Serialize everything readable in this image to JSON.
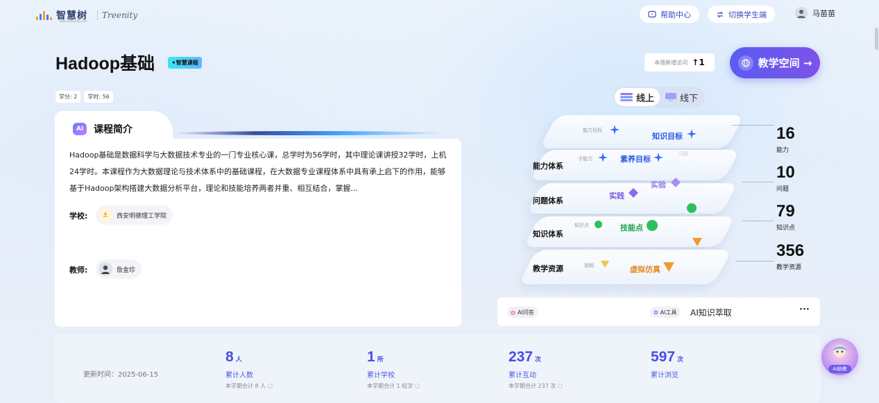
{
  "header": {
    "logo_cn": "智慧树",
    "logo_sub": "www.zhihuishu.com",
    "logo_en": "Treenity",
    "help": "帮助中心",
    "switch": "切换学生端",
    "user": "马苗苗"
  },
  "course": {
    "title": "Hadoop基础",
    "tag": "✦智慧课程",
    "credits": "学分: 2",
    "hours": "学时: 56",
    "intro_title": "课程简介",
    "ai_badge": "AI",
    "description": "Hadoop基础是数据科学与大数据技术专业的一门专业核心课，总学时为56学时，其中理论课讲授32学时，上机24学时。本课程作为大数据理论与技术体系中的基础课程，在大数据专业课程体系中具有承上启下的作用，能够基于Hadoop架构搭建大数据分析平台，理论和技能培养两者并重、相互结合，掌握...",
    "school_label": "学校:",
    "school": "西安明德理工学院",
    "teacher_label": "教师:",
    "teacher": "詹金珍"
  },
  "visits": {
    "label": "本周新增访问",
    "value": "1",
    "arrow": "↑"
  },
  "space_button": "教学空间 →",
  "mode": {
    "online": "线上",
    "offline": "线下"
  },
  "graph": {
    "systems": [
      "能力体系",
      "问题体系",
      "知识体系",
      "教学资源"
    ],
    "nodes": {
      "ability_goal": "能力目标",
      "knowledge_goal": "知识目标",
      "sub_ability": "子能力",
      "literacy_goal": "素养目标",
      "problem": "问题",
      "practice": "实践",
      "experiment": "实验",
      "knowledge_point": "知识点",
      "skill_point": "技能点",
      "video": "视频",
      "virtual_sim": "虚拟仿真"
    }
  },
  "stats": [
    {
      "value": "16",
      "label": "能力"
    },
    {
      "value": "10",
      "label": "问题"
    },
    {
      "value": "79",
      "label": "知识点"
    },
    {
      "value": "356",
      "label": "教学资源"
    }
  ],
  "ai_bar": {
    "qa": "AI问答",
    "tool": "AI工具",
    "tool_text": "AI知识萃取",
    "more": "···"
  },
  "bottom": {
    "updated": "更新时间：2025-06-15",
    "items": [
      {
        "value": "8",
        "unit": "人",
        "label": "累计人数",
        "sub": "本学期合计 8 人"
      },
      {
        "value": "1",
        "unit": "所",
        "label": "累计学校",
        "sub": "本学期合计 1 校次"
      },
      {
        "value": "237",
        "unit": "次",
        "label": "累计互动",
        "sub": "本学期合计 237 次"
      },
      {
        "value": "597",
        "unit": "次",
        "label": "累计浏览",
        "sub": ""
      }
    ]
  },
  "ai_teach": "AI助教",
  "colors": {
    "accent": "#5a5cf2",
    "stat_blue": "#4a4ee0"
  }
}
